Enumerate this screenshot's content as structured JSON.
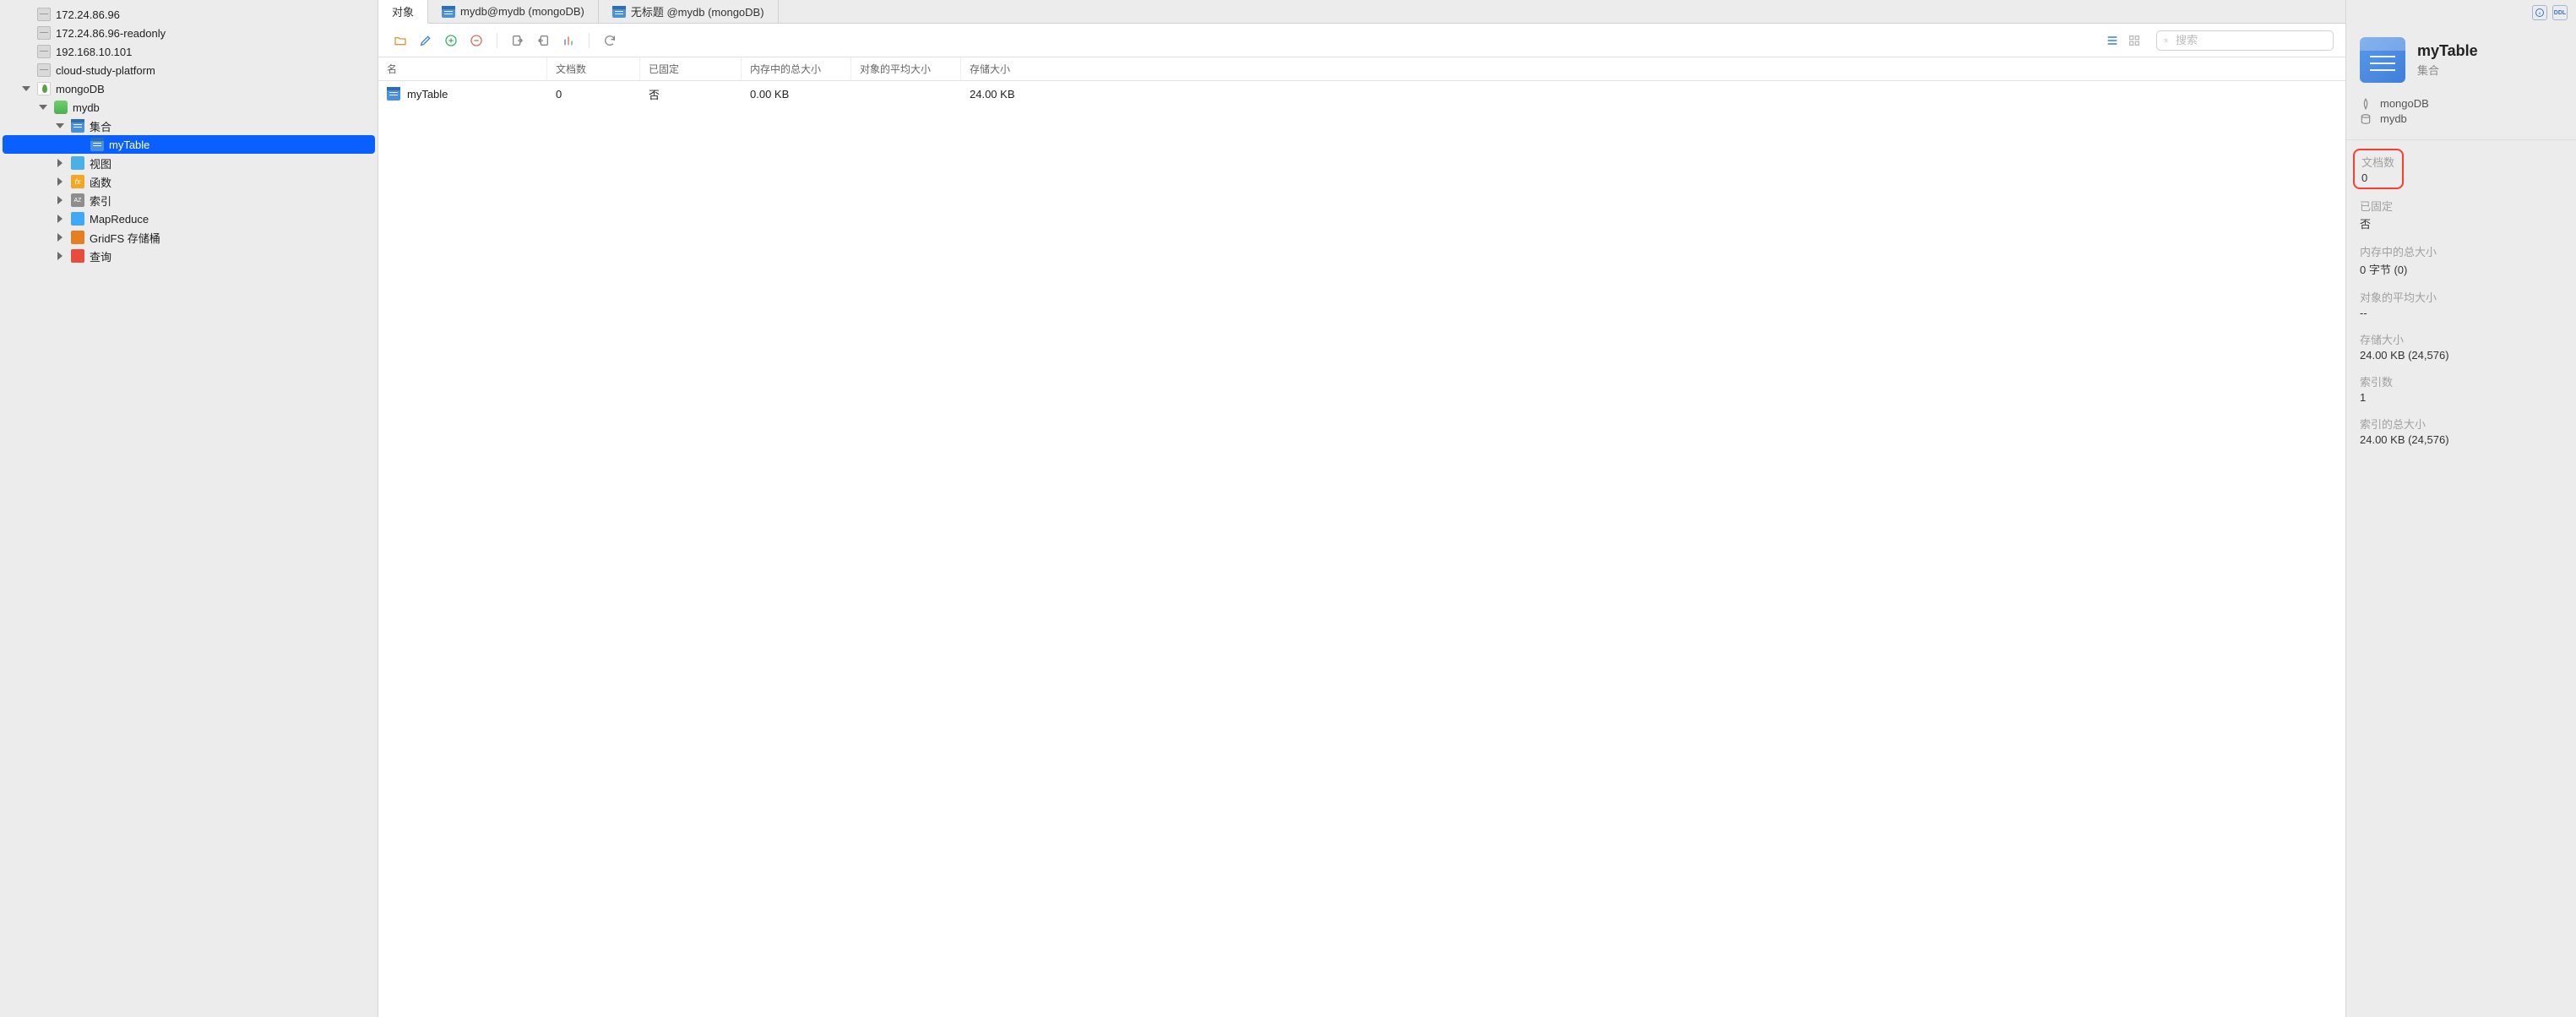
{
  "sidebar": {
    "nodes": [
      {
        "label": "172.24.86.96",
        "icon": "server",
        "indent": 1,
        "chev": "none"
      },
      {
        "label": "172.24.86.96-readonly",
        "icon": "server",
        "indent": 1,
        "chev": "none"
      },
      {
        "label": "192.168.10.101",
        "icon": "server",
        "indent": 1,
        "chev": "none"
      },
      {
        "label": "cloud-study-platform",
        "icon": "server",
        "indent": 1,
        "chev": "none"
      },
      {
        "label": "mongoDB",
        "icon": "mongo",
        "indent": 1,
        "chev": "down"
      },
      {
        "label": "mydb",
        "icon": "db",
        "indent": 2,
        "chev": "down"
      },
      {
        "label": "集合",
        "icon": "table",
        "indent": 3,
        "chev": "down"
      },
      {
        "label": "myTable",
        "icon": "table",
        "indent": 4,
        "chev": "none",
        "selected": true
      },
      {
        "label": "视图",
        "icon": "view",
        "indent": 3,
        "chev": "right"
      },
      {
        "label": "函数",
        "icon": "func",
        "indent": 3,
        "chev": "right"
      },
      {
        "label": "索引",
        "icon": "index",
        "indent": 3,
        "chev": "right"
      },
      {
        "label": "MapReduce",
        "icon": "mr",
        "indent": 3,
        "chev": "right"
      },
      {
        "label": "GridFS 存储桶",
        "icon": "bucket",
        "indent": 3,
        "chev": "right"
      },
      {
        "label": "查询",
        "icon": "query",
        "indent": 3,
        "chev": "right"
      }
    ]
  },
  "tabs": [
    {
      "label": "对象",
      "active": true
    },
    {
      "label": "mydb@mydb (mongoDB)",
      "icon": "table"
    },
    {
      "label": "无标题 @mydb (mongoDB)",
      "icon": "table"
    }
  ],
  "toolbar": {
    "search_placeholder": "搜索"
  },
  "table": {
    "columns": [
      "名",
      "文档数",
      "已固定",
      "内存中的总大小",
      "对象的平均大小",
      "存储大小"
    ],
    "rows": [
      {
        "name": "myTable",
        "docs": "0",
        "pinned": "否",
        "mem": "0.00 KB",
        "avg": "",
        "store": "24.00 KB"
      }
    ]
  },
  "info": {
    "title": "myTable",
    "subtitle": "集合",
    "meta_engine": "mongoDB",
    "meta_db": "mydb",
    "props": [
      {
        "label": "文档数",
        "value": "0",
        "highlight": true
      },
      {
        "label": "已固定",
        "value": "否"
      },
      {
        "label": "内存中的总大小",
        "value": "0 字节 (0)"
      },
      {
        "label": "对象的平均大小",
        "value": "--"
      },
      {
        "label": "存储大小",
        "value": "24.00 KB (24,576)"
      },
      {
        "label": "索引数",
        "value": "1"
      },
      {
        "label": "索引的总大小",
        "value": "24.00 KB (24,576)"
      }
    ]
  }
}
